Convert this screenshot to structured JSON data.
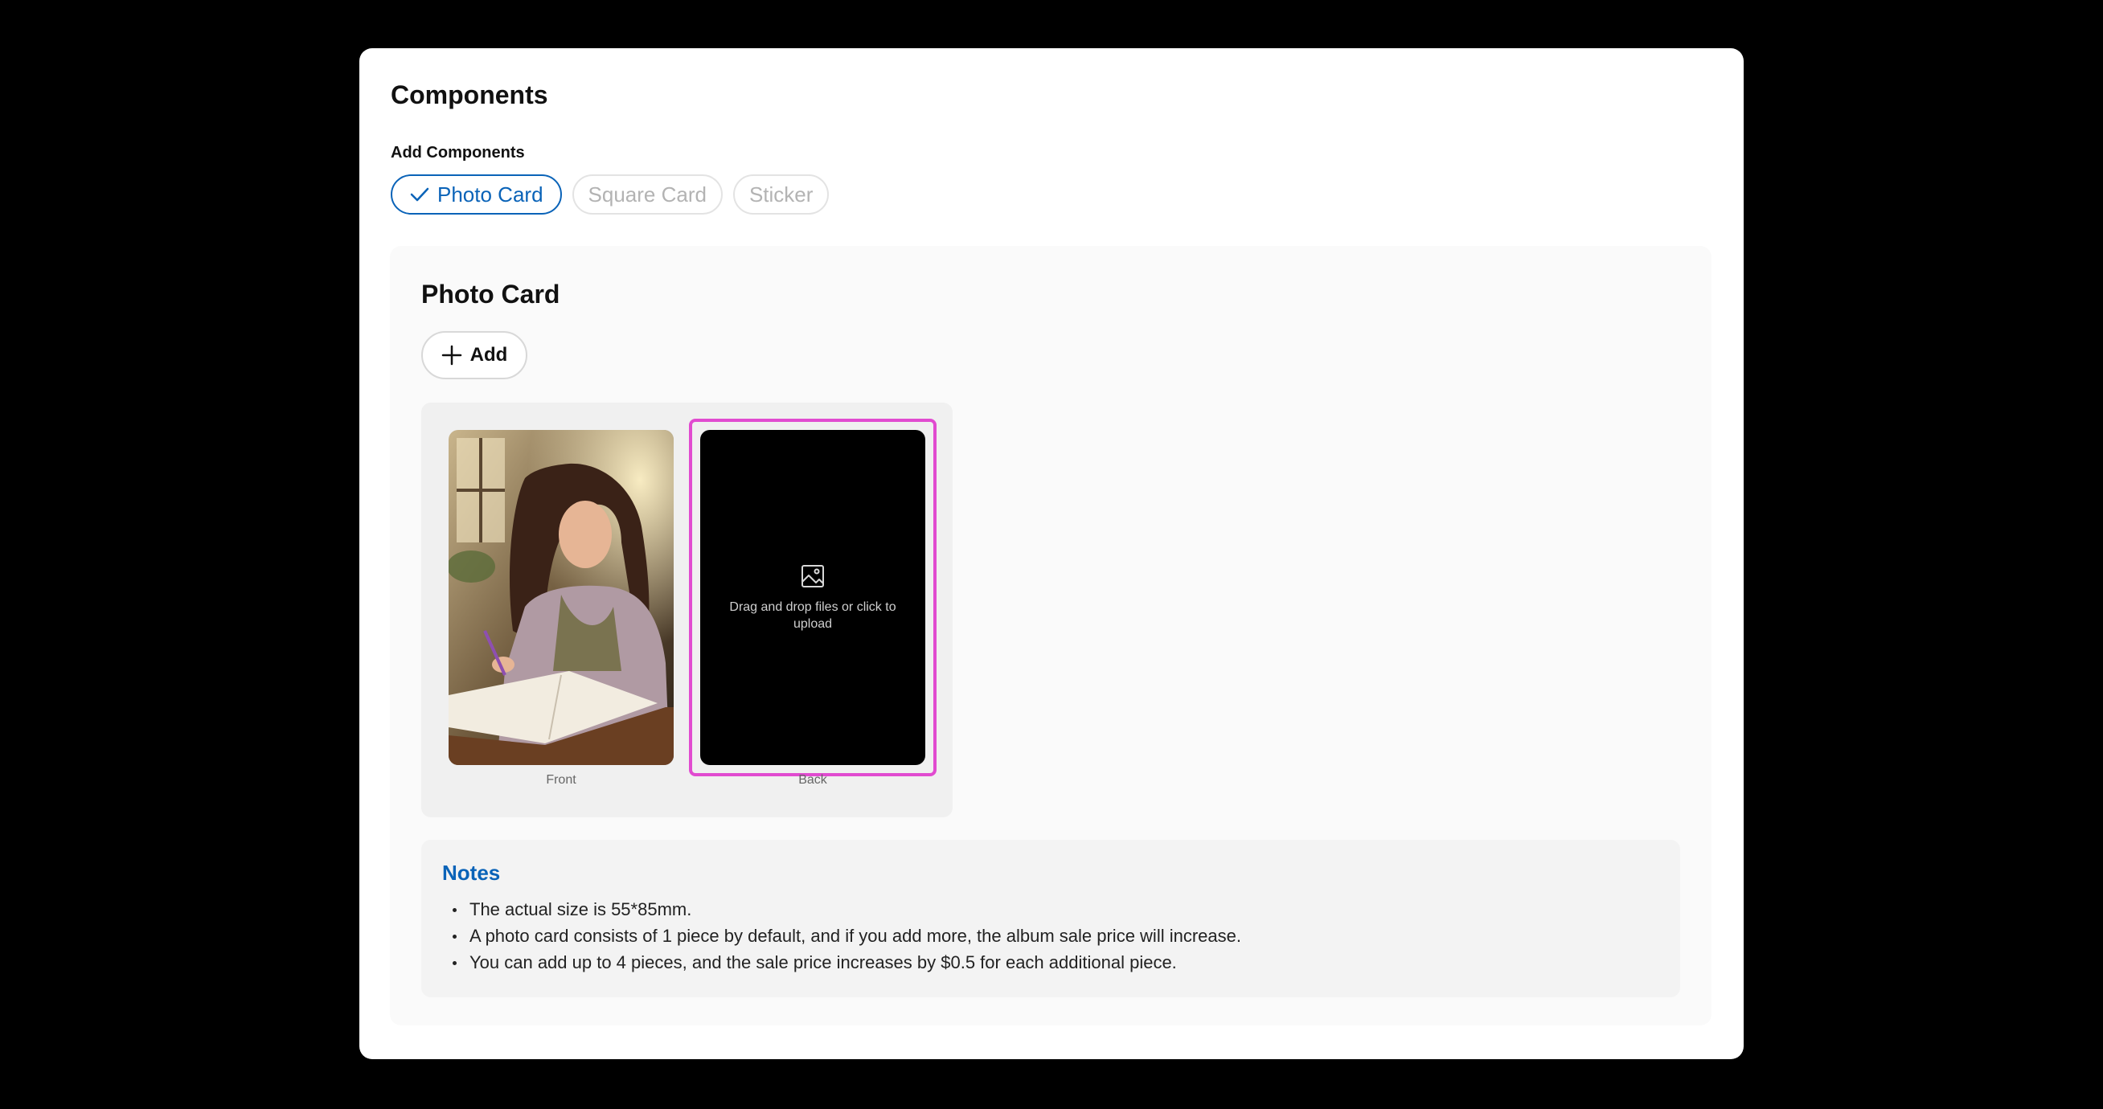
{
  "modal": {
    "title": "Components",
    "add_components_label": "Add Components",
    "chips": [
      {
        "label": "Photo Card",
        "selected": true
      },
      {
        "label": "Square Card",
        "selected": false
      },
      {
        "label": "Sticker",
        "selected": false
      }
    ]
  },
  "panel": {
    "title": "Photo Card",
    "add_label": "Add",
    "cards": {
      "front_label": "Front",
      "back_label": "Back",
      "upload_text": "Drag and drop files or click to upload",
      "upload_icon": "image-icon"
    },
    "notes": {
      "title": "Notes",
      "items": [
        "The actual size is 55*85mm.",
        "A photo card consists of 1 piece by default, and if you add more, the album sale price will increase.",
        "You can add up to 4 pieces, and the sale price increases by $0.5 for each additional piece."
      ]
    }
  },
  "colors": {
    "accent": "#0a63b8",
    "highlight": "#e14bd0",
    "backdrop": "#000000"
  }
}
